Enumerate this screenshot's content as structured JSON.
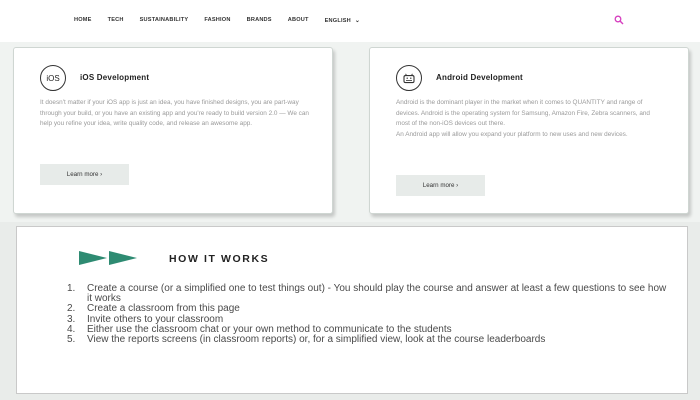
{
  "nav": {
    "items": [
      "HOME",
      "TECH",
      "SUSTAINABILITY",
      "FASHION",
      "BRANDS",
      "ABOUT",
      "ENGLISH"
    ]
  },
  "colors": {
    "accent": "#d63fbf",
    "arrow": "#2e8b72"
  },
  "ios_card": {
    "icon_label": "iOS",
    "title": "iOS Development",
    "text": "It doesn't matter if your iOS app is just an idea, you have finished designs, you are part-way through your build, or you have an existing app and you're ready to build version 2.0 — We can help you refine your idea, write quality code, and release an awesome app.",
    "button": "Learn more ›"
  },
  "android_card": {
    "title": "Android Development",
    "text_1": "Android is the dominant player in the market when it comes to QUANTITY and range of devices. Android is the operating system for Samsung, Amazon Fire, Zebra scanners, and most of the non-iOS devices out there.",
    "text_2": "An Android app will allow you expand your platform to new uses and new devices.",
    "button": "Learn more ›"
  },
  "how_it_works": {
    "title": "HOW IT WORKS",
    "steps": [
      {
        "num": "1.",
        "text": "Create a course (or a simplified one to test things out) - You should play the course and answer at least a few questions to see how it works"
      },
      {
        "num": "2.",
        "text": "Create a classroom from this page"
      },
      {
        "num": "3.",
        "text": "Invite others to your classroom"
      },
      {
        "num": "4.",
        "text": "Either use the classroom chat or your own method to communicate to the students"
      },
      {
        "num": "5.",
        "text": "View the reports screens (in classroom reports) or, for a simplified view, look at the course leaderboards"
      }
    ]
  }
}
